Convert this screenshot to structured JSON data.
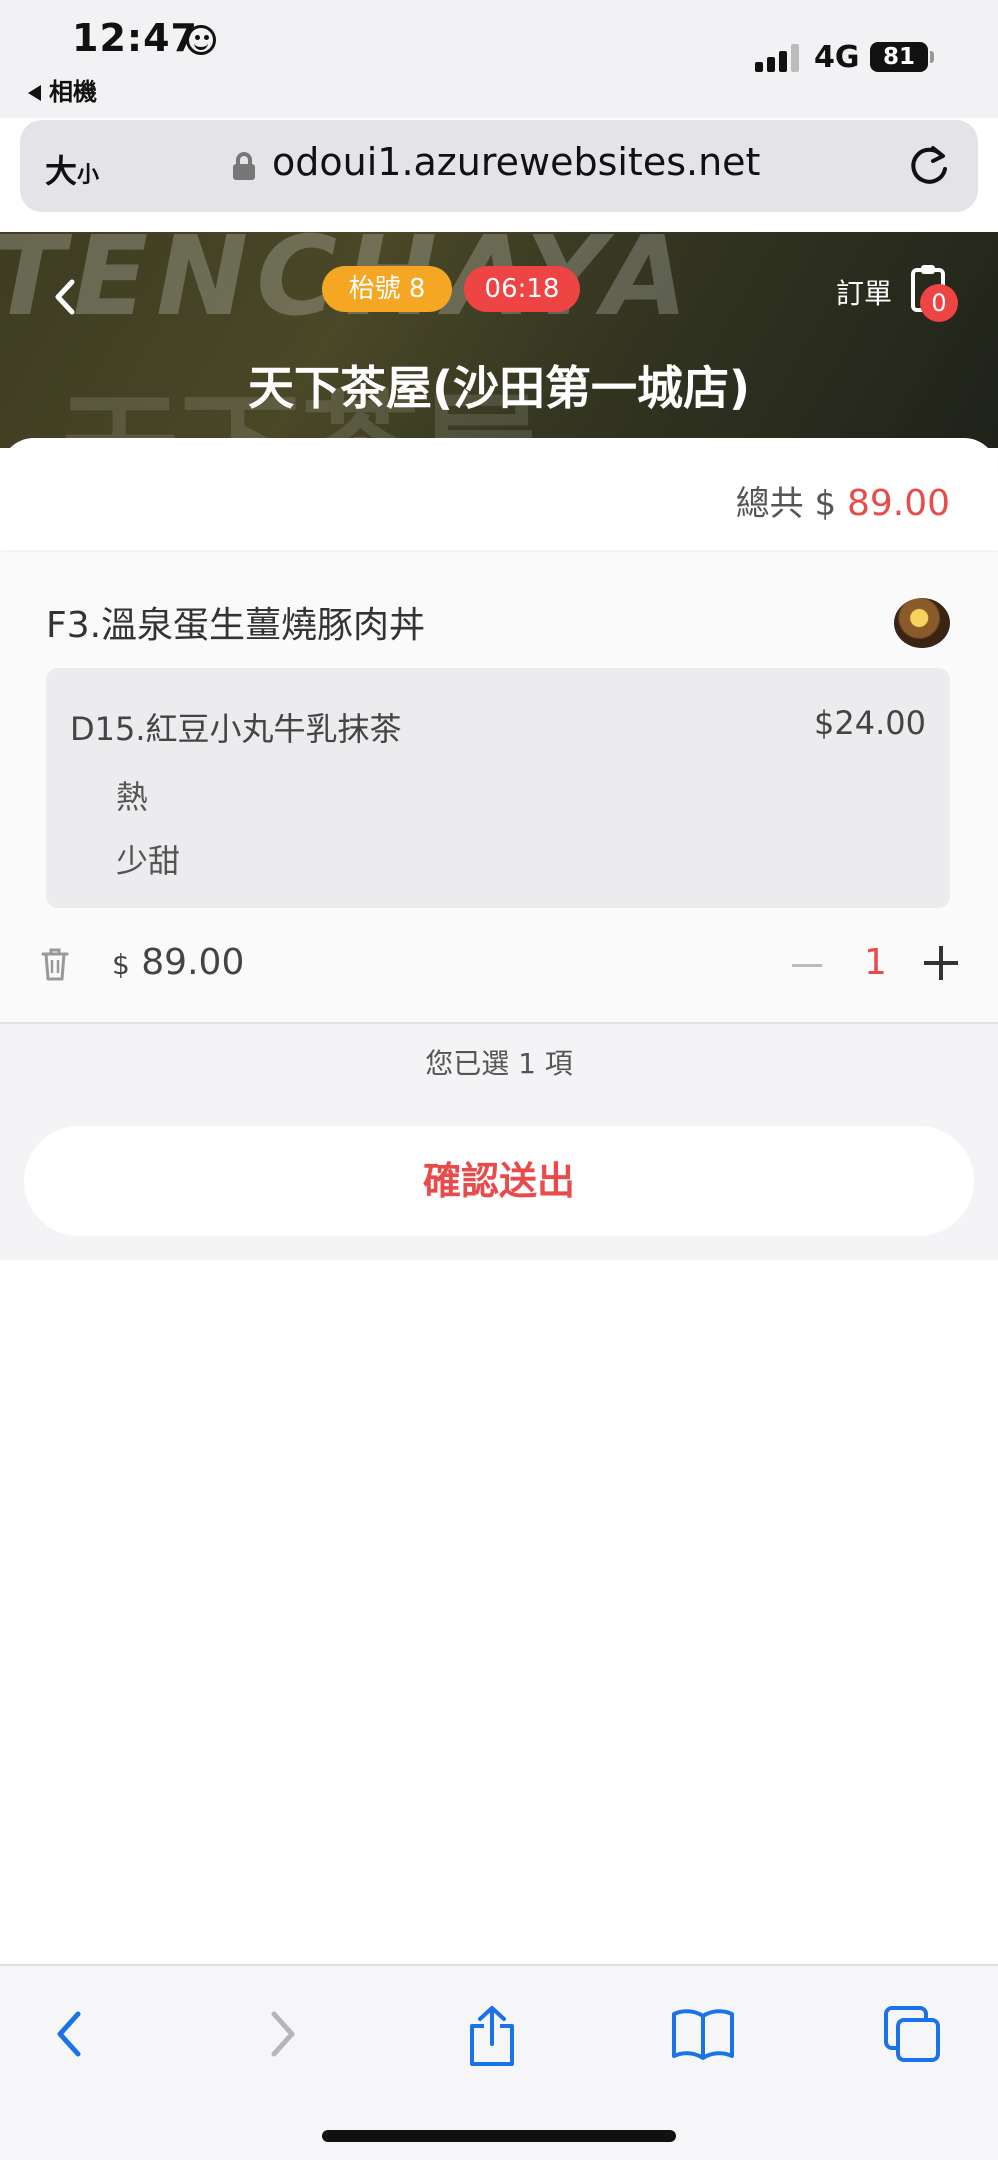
{
  "status_bar": {
    "time": "12:47",
    "back_app": "相機",
    "network": "4G",
    "battery": "81"
  },
  "browser": {
    "text_size_big": "大",
    "text_size_small": "小",
    "url": "odoui1.azurewebsites.net"
  },
  "header": {
    "bg_text": "TENCHAYA",
    "bg_text2": "天下茶屋",
    "table_badge": "枱號 8",
    "timer_badge": "06:18",
    "order_label": "訂單",
    "order_count": "0",
    "store_name": "天下茶屋(沙田第一城店)"
  },
  "summary": {
    "total_label": "總共 $ ",
    "total_amount": "89.00"
  },
  "cart": {
    "item_name": "F3.溫泉蛋生薑燒豚肉丼",
    "addon": {
      "name": "D15.紅豆小丸牛乳抹茶",
      "price": "$24.00",
      "option1": "熱",
      "option2": "少甜"
    },
    "currency": "$",
    "item_price": "89.00",
    "quantity": "1",
    "selected_text": "您已選 1 項",
    "confirm_label": "確認送出"
  },
  "colors": {
    "accent_red": "#e94b4b",
    "badge_orange": "#f5a623",
    "safari_blue": "#1a73e8"
  },
  "icons": {
    "toolbar": [
      "back-icon",
      "forward-icon",
      "share-icon",
      "bookmarks-icon",
      "tabs-icon"
    ]
  }
}
